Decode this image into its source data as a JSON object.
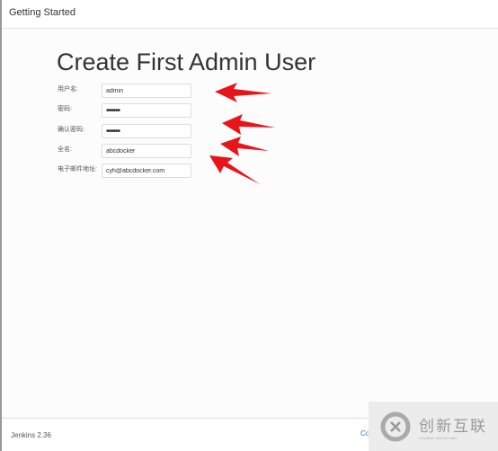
{
  "header": {
    "title": "Getting Started"
  },
  "page_title": "Create First Admin User",
  "fields": [
    {
      "label": "用户名:",
      "value": "admin",
      "type": "text"
    },
    {
      "label": "密码:",
      "value": "123456",
      "type": "password"
    },
    {
      "label": "确认密码:",
      "value": "123456",
      "type": "password"
    },
    {
      "label": "全名:",
      "value": "abcdocker",
      "type": "text"
    },
    {
      "label": "电子邮件地址:",
      "value": "cyh@abcdocker.com",
      "type": "text"
    }
  ],
  "footer": {
    "version": "Jenkins 2.36",
    "continue_label": "Co"
  },
  "watermark": {
    "name": "创新互联",
    "sub": "CHUANG XIN HU LIAN"
  },
  "colors": {
    "arrow": "#e8141a",
    "link": "#3b6fb6"
  }
}
